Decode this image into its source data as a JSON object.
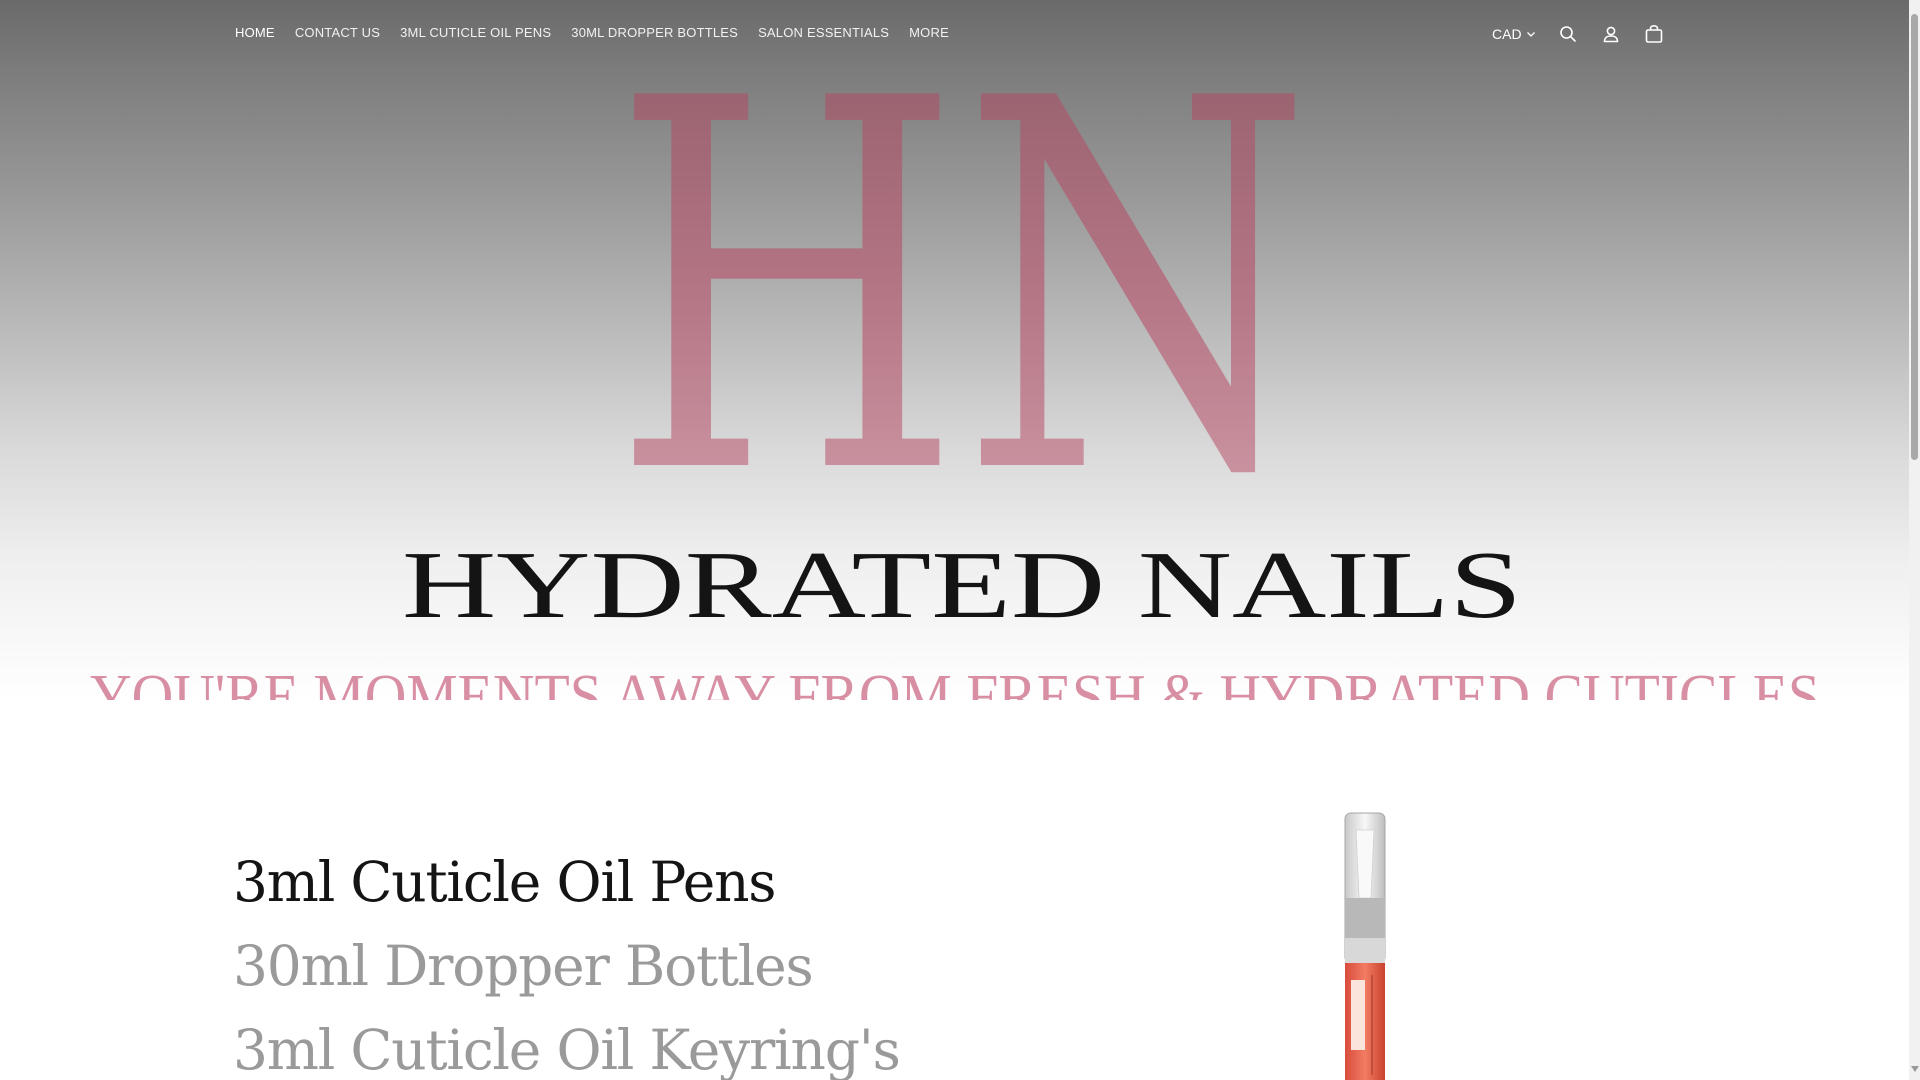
{
  "nav": {
    "items": [
      {
        "label": "HOME",
        "active": true
      },
      {
        "label": "CONTACT US",
        "active": false
      },
      {
        "label": "3ML CUTICLE OIL PENS",
        "active": false
      },
      {
        "label": "30ML DROPPER BOTTLES",
        "active": false
      },
      {
        "label": "SALON ESSENTIALS",
        "active": false
      },
      {
        "label": "MORE",
        "active": false
      }
    ]
  },
  "header": {
    "currency": "CAD",
    "icons": [
      "search-icon",
      "account-icon",
      "cart-icon"
    ]
  },
  "hero": {
    "monogram": "HN",
    "brand": "HYDRATED NAILS",
    "tagline": "YOU'RE MOMENTS AWAY FROM FRESH & HYDRATED CUTICLES",
    "monogram_color": "#c48a99",
    "brand_color": "#141414",
    "tagline_color": "#d98fa3"
  },
  "collections": {
    "items": [
      {
        "label": "3ml Cuticle Oil Pens",
        "active": true
      },
      {
        "label": "30ml Dropper Bottles",
        "active": false
      },
      {
        "label": "3ml Cuticle Oil Keyring's",
        "active": false
      }
    ]
  }
}
